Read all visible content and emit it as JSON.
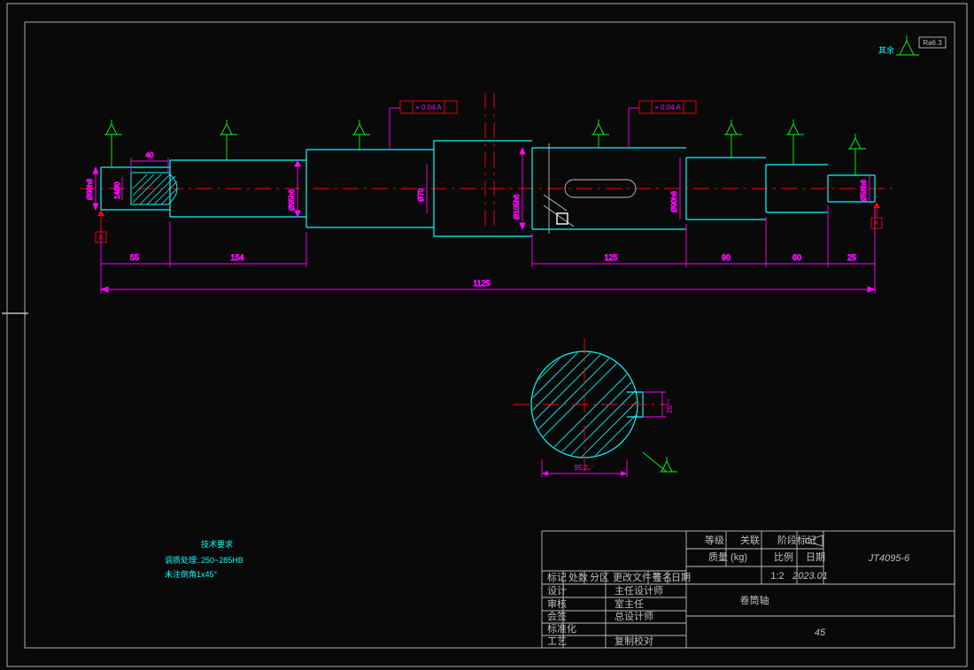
{
  "frame": {
    "drawing_no": "JT4095-6",
    "date": "2023.01",
    "scale": "1:2",
    "part_name": "卷筒轴",
    "material": "45",
    "surface_default": "Ra6.3",
    "surface_label": "其余"
  },
  "title_block": {
    "row1": [
      "标记",
      "处数",
      "分区",
      "更改文件号",
      "签名",
      "日期"
    ],
    "row2": [
      "设计",
      "",
      "主任设计师"
    ],
    "row3": [
      "审核",
      "",
      "室主任"
    ],
    "row4": [
      "会签",
      "",
      "总设计师"
    ],
    "row5": [
      "标准化",
      "",
      ""
    ],
    "row6": [
      "工艺",
      "",
      "复制校对"
    ],
    "hdr": {
      "a": "等级",
      "b": "关联",
      "c": "阶段标记",
      "mass": "质量 (kg)",
      "scale": "比例",
      "date": "日期"
    }
  },
  "notes": {
    "title": "技术要求",
    "line1": "调质处理: 250~285HB",
    "line2": "未注倒角1x45°"
  },
  "dims": {
    "overall": "1125",
    "seg": [
      "55",
      "154",
      "125",
      "90",
      "60",
      "25"
    ],
    "dia": [
      "Ø80h6",
      "14Ø0",
      "Ø95h6",
      "Ø70",
      "Ø105h6",
      "Ø90h6",
      "Ø58h6"
    ],
    "hole_len": "40",
    "sect_w": "95.2₀⁻",
    "sect_h": "28⁺⁰"
  },
  "fcf": {
    "a": "⌖ 0.04 A",
    "b": "⌖ 0.04 A"
  }
}
